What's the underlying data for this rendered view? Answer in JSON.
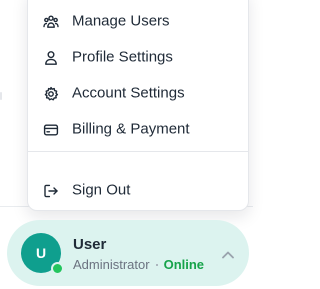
{
  "menu": {
    "items": [
      {
        "label": "Manage Users",
        "icon": "users-icon"
      },
      {
        "label": "Profile Settings",
        "icon": "user-icon"
      },
      {
        "label": "Account Settings",
        "icon": "gear-icon"
      },
      {
        "label": "Billing & Payment",
        "icon": "credit-card-icon"
      },
      {
        "label": "Sign Out",
        "icon": "sign-out-icon"
      }
    ]
  },
  "user": {
    "avatar_initial": "U",
    "name": "User",
    "role": "Administrator",
    "status": "Online",
    "expand_icon": "chevron-up-icon"
  },
  "colors": {
    "accent": "#0f9f8e",
    "card_background": "#dcf3ef",
    "online": "#22c55e",
    "online_text": "#16a34a"
  }
}
